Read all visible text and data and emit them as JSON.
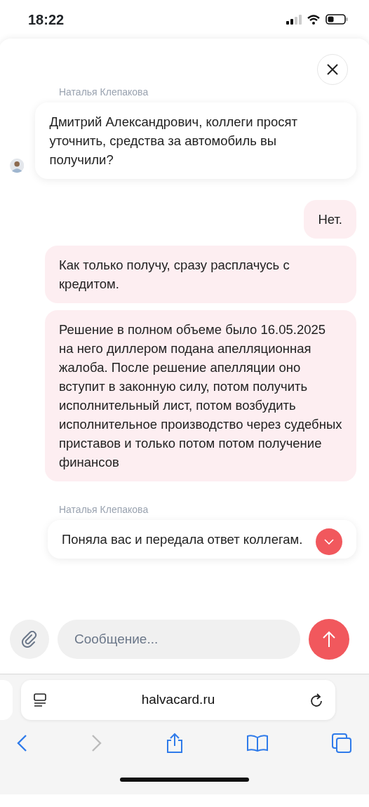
{
  "status_bar": {
    "time": "18:22"
  },
  "messages": [
    {
      "kind": "incoming",
      "sender": "Наталья Клепакова",
      "text": "Дмитрий Александрович, коллеги просят уточнить, средства за автомобиль вы получили?",
      "avatar": true
    },
    {
      "kind": "outgoing",
      "text": "Нет."
    },
    {
      "kind": "outgoing",
      "text": "Как только получу, сразу расплачусь с кредитом."
    },
    {
      "kind": "outgoing",
      "text": "Решение в полном объеме было 16.05.2025 на него диллером подана апелляционная жалоба. После решение апелляции оно вступит в законную силу, потом получить исполнительный лист, потом возбудить исполнительное производство через судебных приставов и только потом потом получение финансов"
    },
    {
      "kind": "incoming",
      "sender": "Наталья Клепакова",
      "text": "Поняла вас и передала ответ коллегам.",
      "avatar": false
    }
  ],
  "composer": {
    "placeholder": "Сообщение..."
  },
  "browser": {
    "url": "halvacard.ru",
    "forward_disabled": true
  }
}
